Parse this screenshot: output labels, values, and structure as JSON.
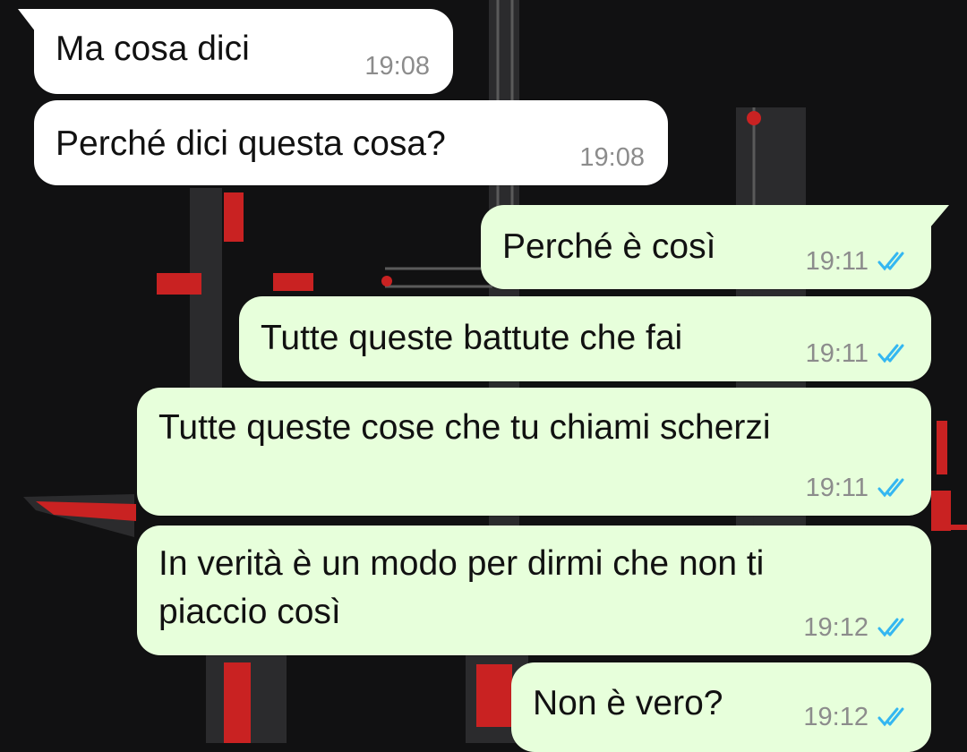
{
  "colors": {
    "incoming_bubble": "#ffffff",
    "outgoing_bubble": "#e7ffdb",
    "read_check": "#34b7f1",
    "timestamp": "#8c8c8c",
    "wallpaper_dark": "#111112",
    "wallpaper_red": "#c92222"
  },
  "messages": [
    {
      "direction": "incoming",
      "text": "Ma cosa dici",
      "time": "19:08"
    },
    {
      "direction": "incoming",
      "text": "Perché dici questa cosa?",
      "time": "19:08"
    },
    {
      "direction": "outgoing",
      "text": "Perché è così",
      "time": "19:11",
      "status_icon": "double-check-icon"
    },
    {
      "direction": "outgoing",
      "text": "Tutte queste battute che fai",
      "time": "19:11",
      "status_icon": "double-check-icon"
    },
    {
      "direction": "outgoing",
      "text": "Tutte queste cose che tu chiami scherzi",
      "time": "19:11",
      "status_icon": "double-check-icon"
    },
    {
      "direction": "outgoing",
      "text": "In verità è un modo per dirmi che non ti\npiaccio così",
      "time": "19:12",
      "status_icon": "double-check-icon"
    },
    {
      "direction": "outgoing",
      "text": "Non è vero?",
      "time": "19:12",
      "status_icon": "double-check-icon"
    }
  ]
}
